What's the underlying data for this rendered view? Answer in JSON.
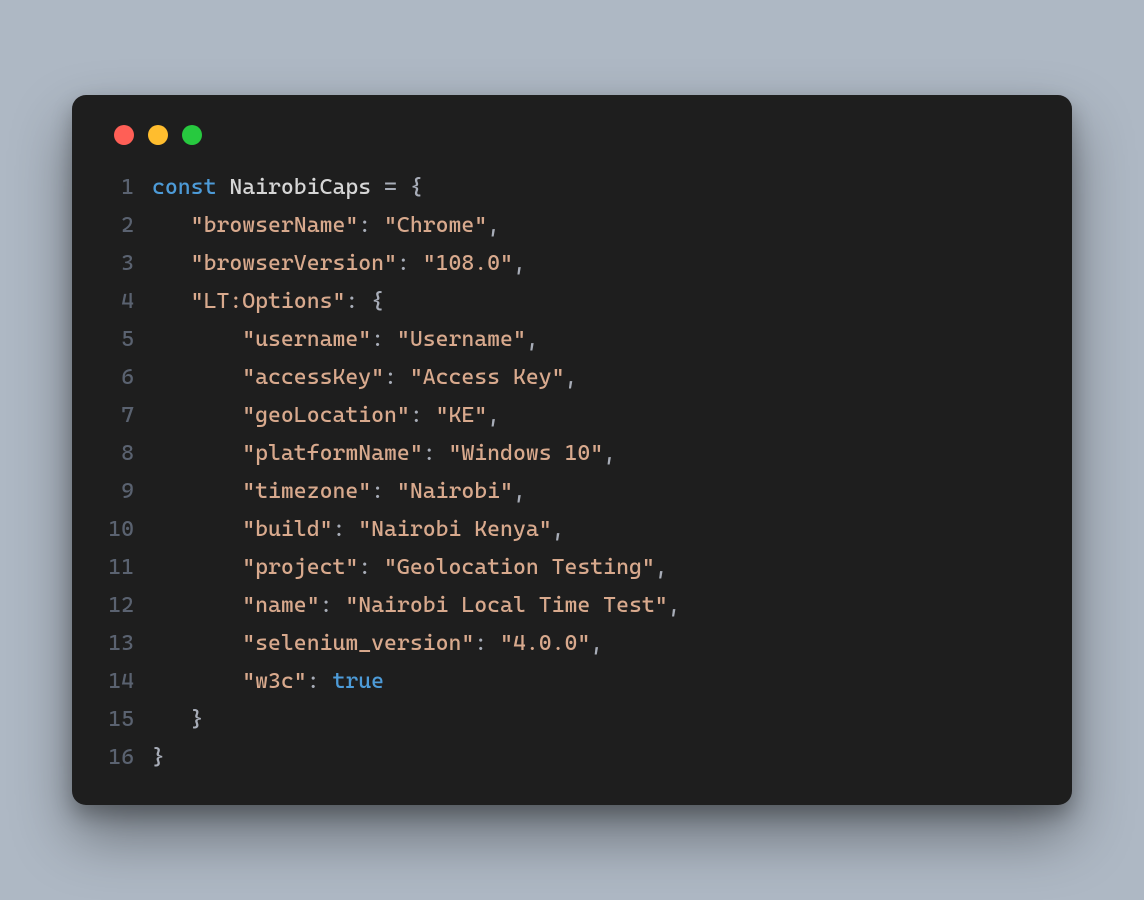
{
  "window": {
    "traffic_lights": [
      "close",
      "minimize",
      "zoom"
    ]
  },
  "code": {
    "keyword_const": "const",
    "var_name": "NairobiCaps",
    "equals": "=",
    "open_brace": "{",
    "close_brace": "}",
    "comma": ",",
    "colon": ":",
    "lines": [
      {
        "n": "1",
        "indent": "",
        "k": null,
        "v": null,
        "head": true,
        "open": false,
        "close": false
      },
      {
        "n": "2",
        "indent": "   ",
        "k": "\"browserName\"",
        "v": "\"Chrome\"",
        "head": false,
        "open": false,
        "close": false,
        "trail_comma": true
      },
      {
        "n": "3",
        "indent": "   ",
        "k": "\"browserVersion\"",
        "v": "\"108.0\"",
        "head": false,
        "open": false,
        "close": false,
        "trail_comma": true
      },
      {
        "n": "4",
        "indent": "   ",
        "k": "\"LT:Options\"",
        "v": null,
        "head": false,
        "open": true,
        "close": false
      },
      {
        "n": "5",
        "indent": "       ",
        "k": "\"username\"",
        "v": "\"Username\"",
        "head": false,
        "open": false,
        "close": false,
        "trail_comma": true
      },
      {
        "n": "6",
        "indent": "       ",
        "k": "\"accessKey\"",
        "v": "\"Access Key\"",
        "head": false,
        "open": false,
        "close": false,
        "trail_comma": true
      },
      {
        "n": "7",
        "indent": "       ",
        "k": "\"geoLocation\"",
        "v": "\"KE\"",
        "head": false,
        "open": false,
        "close": false,
        "trail_comma": true
      },
      {
        "n": "8",
        "indent": "       ",
        "k": "\"platformName\"",
        "v": "\"Windows 10\"",
        "head": false,
        "open": false,
        "close": false,
        "trail_comma": true
      },
      {
        "n": "9",
        "indent": "       ",
        "k": "\"timezone\"",
        "v": "\"Nairobi\"",
        "head": false,
        "open": false,
        "close": false,
        "trail_comma": true
      },
      {
        "n": "10",
        "indent": "       ",
        "k": "\"build\"",
        "v": "\"Nairobi Kenya\"",
        "head": false,
        "open": false,
        "close": false,
        "trail_comma": true
      },
      {
        "n": "11",
        "indent": "       ",
        "k": "\"project\"",
        "v": "\"Geolocation Testing\"",
        "head": false,
        "open": false,
        "close": false,
        "trail_comma": true
      },
      {
        "n": "12",
        "indent": "       ",
        "k": "\"name\"",
        "v": "\"Nairobi Local Time Test\"",
        "head": false,
        "open": false,
        "close": false,
        "trail_comma": true
      },
      {
        "n": "13",
        "indent": "       ",
        "k": "\"selenium_version\"",
        "v": "\"4.0.0\"",
        "head": false,
        "open": false,
        "close": false,
        "trail_comma": true
      },
      {
        "n": "14",
        "indent": "       ",
        "k": "\"w3c\"",
        "v": "true",
        "head": false,
        "open": false,
        "close": false,
        "bool": true,
        "trail_comma": false
      },
      {
        "n": "15",
        "indent": "   ",
        "k": null,
        "v": null,
        "head": false,
        "open": false,
        "close": true
      },
      {
        "n": "16",
        "indent": "",
        "k": null,
        "v": null,
        "head": false,
        "open": false,
        "close": true
      }
    ]
  }
}
